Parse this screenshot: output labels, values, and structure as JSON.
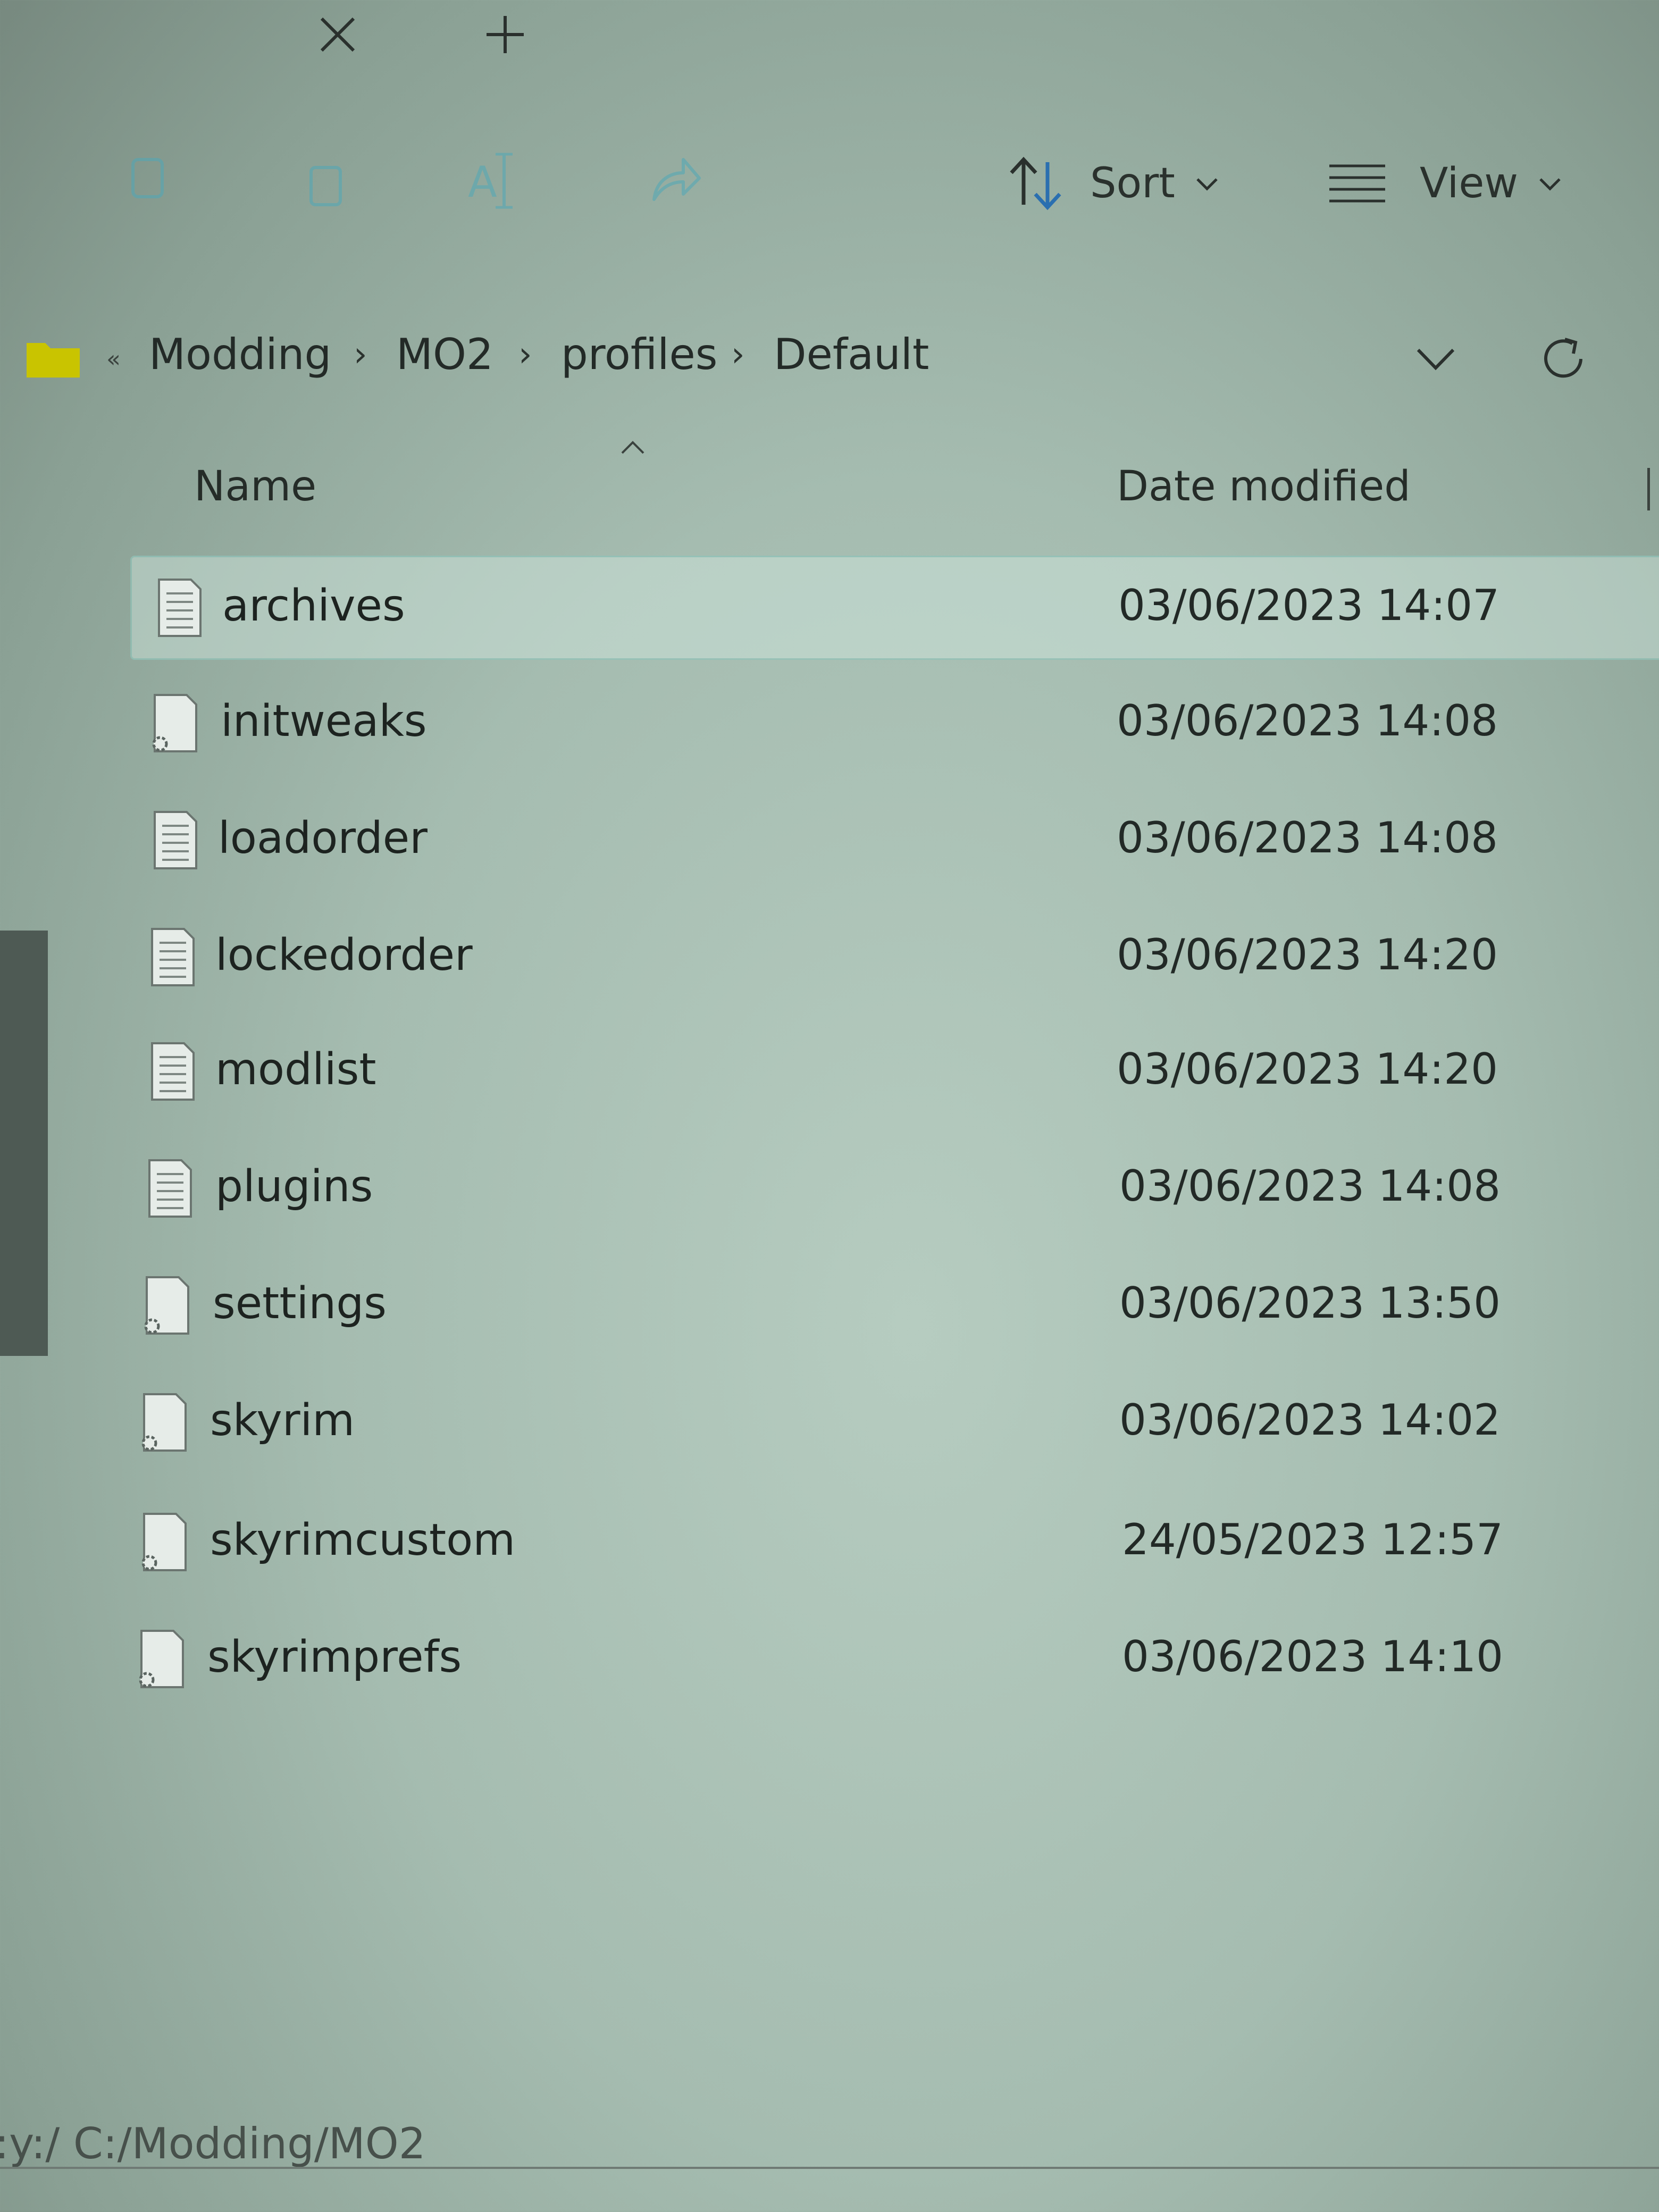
{
  "tabs": {
    "close_icon": "close-icon",
    "new_tab_icon": "plus-icon"
  },
  "toolbar": {
    "sort_label": "Sort",
    "view_label": "View"
  },
  "address": {
    "overflow": "«",
    "crumbs": [
      "Modding",
      "MO2",
      "profiles",
      "Default"
    ]
  },
  "columns": {
    "name": "Name",
    "date_modified": "Date modified"
  },
  "files": [
    {
      "name": "archives",
      "date": "03/06/2023 14:07",
      "icon": "text-file-icon"
    },
    {
      "name": "initweaks",
      "date": "03/06/2023 14:08",
      "icon": "settings-file-icon"
    },
    {
      "name": "loadorder",
      "date": "03/06/2023 14:08",
      "icon": "text-file-icon"
    },
    {
      "name": "lockedorder",
      "date": "03/06/2023 14:20",
      "icon": "text-file-icon"
    },
    {
      "name": "modlist",
      "date": "03/06/2023 14:20",
      "icon": "text-file-icon"
    },
    {
      "name": "plugins",
      "date": "03/06/2023 14:08",
      "icon": "text-file-icon"
    },
    {
      "name": "settings",
      "date": "03/06/2023 13:50",
      "icon": "settings-file-icon"
    },
    {
      "name": "skyrim",
      "date": "03/06/2023 14:02",
      "icon": "settings-file-icon"
    },
    {
      "name": "skyrimcustom",
      "date": "24/05/2023 12:57",
      "icon": "settings-file-icon"
    },
    {
      "name": "skyrimprefs",
      "date": "03/06/2023 14:10",
      "icon": "settings-file-icon"
    }
  ],
  "status_bar": {
    "path": ":y:/ C:/Modding/MO2"
  },
  "colors": {
    "folder": "#c9c400",
    "accent": "#2a6fb0"
  }
}
